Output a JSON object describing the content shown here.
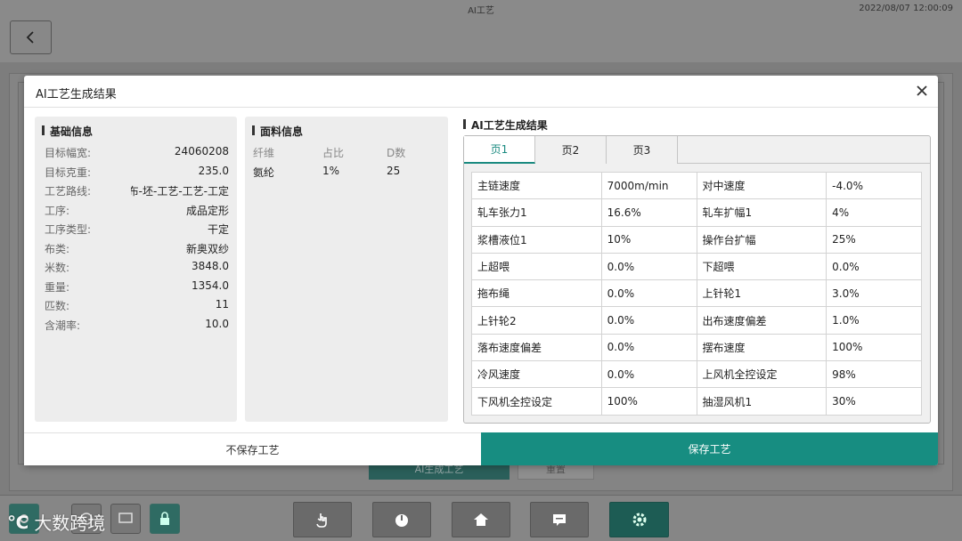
{
  "app": {
    "title": "AI工艺",
    "datetime": "2022/08/07 12:00:09",
    "bg_generate_label": "AI生成工艺",
    "bg_reset_label": "重置"
  },
  "watermark": {
    "logo": "℃",
    "text": "大数跨境"
  },
  "modal": {
    "title": "AI工艺生成结果",
    "basic": {
      "title": "基础信息",
      "rows": [
        {
          "k": "目标幅宽:",
          "v": "24060208"
        },
        {
          "k": "目标克重:",
          "v": "235.0"
        },
        {
          "k": "工艺路线:",
          "v": "坯布-坯-工艺-工艺-工定"
        },
        {
          "k": "工序:",
          "v": "成品定形"
        },
        {
          "k": "工序类型:",
          "v": "干定"
        },
        {
          "k": "布类:",
          "v": "新奥双纱"
        },
        {
          "k": "米数:",
          "v": "3848.0"
        },
        {
          "k": "重量:",
          "v": "1354.0"
        },
        {
          "k": "匹数:",
          "v": "11"
        },
        {
          "k": "含潮率:",
          "v": "10.0"
        }
      ]
    },
    "fabric": {
      "title": "面料信息",
      "headers": [
        "纤维",
        "占比",
        "D数"
      ],
      "rows": [
        [
          "氨纶",
          "1%",
          "25"
        ]
      ]
    },
    "result": {
      "title": "AI工艺生成结果",
      "tabs": [
        "页1",
        "页2",
        "页3"
      ],
      "active_tab": 0,
      "rows": [
        [
          "主链速度",
          "7000m/min",
          "对中速度",
          "-4.0%"
        ],
        [
          "轧车张力1",
          "16.6%",
          "轧车扩幅1",
          "4%"
        ],
        [
          "浆槽液位1",
          "10%",
          "操作台扩幅",
          "25%"
        ],
        [
          "上超喂",
          "0.0%",
          "下超喂",
          "0.0%"
        ],
        [
          "拖布绳",
          "0.0%",
          "上针轮1",
          "3.0%"
        ],
        [
          "上针轮2",
          "0.0%",
          "出布速度偏差",
          "1.0%"
        ],
        [
          "落布速度偏差",
          "0.0%",
          "摆布速度",
          "100%"
        ],
        [
          "冷风速度",
          "0.0%",
          "上风机全控设定",
          "98%"
        ],
        [
          "下风机全控设定",
          "100%",
          "抽湿风机1",
          "30%"
        ]
      ]
    },
    "buttons": {
      "no_save": "不保存工艺",
      "save": "保存工艺"
    }
  },
  "colors": {
    "accent": "#178d81"
  }
}
